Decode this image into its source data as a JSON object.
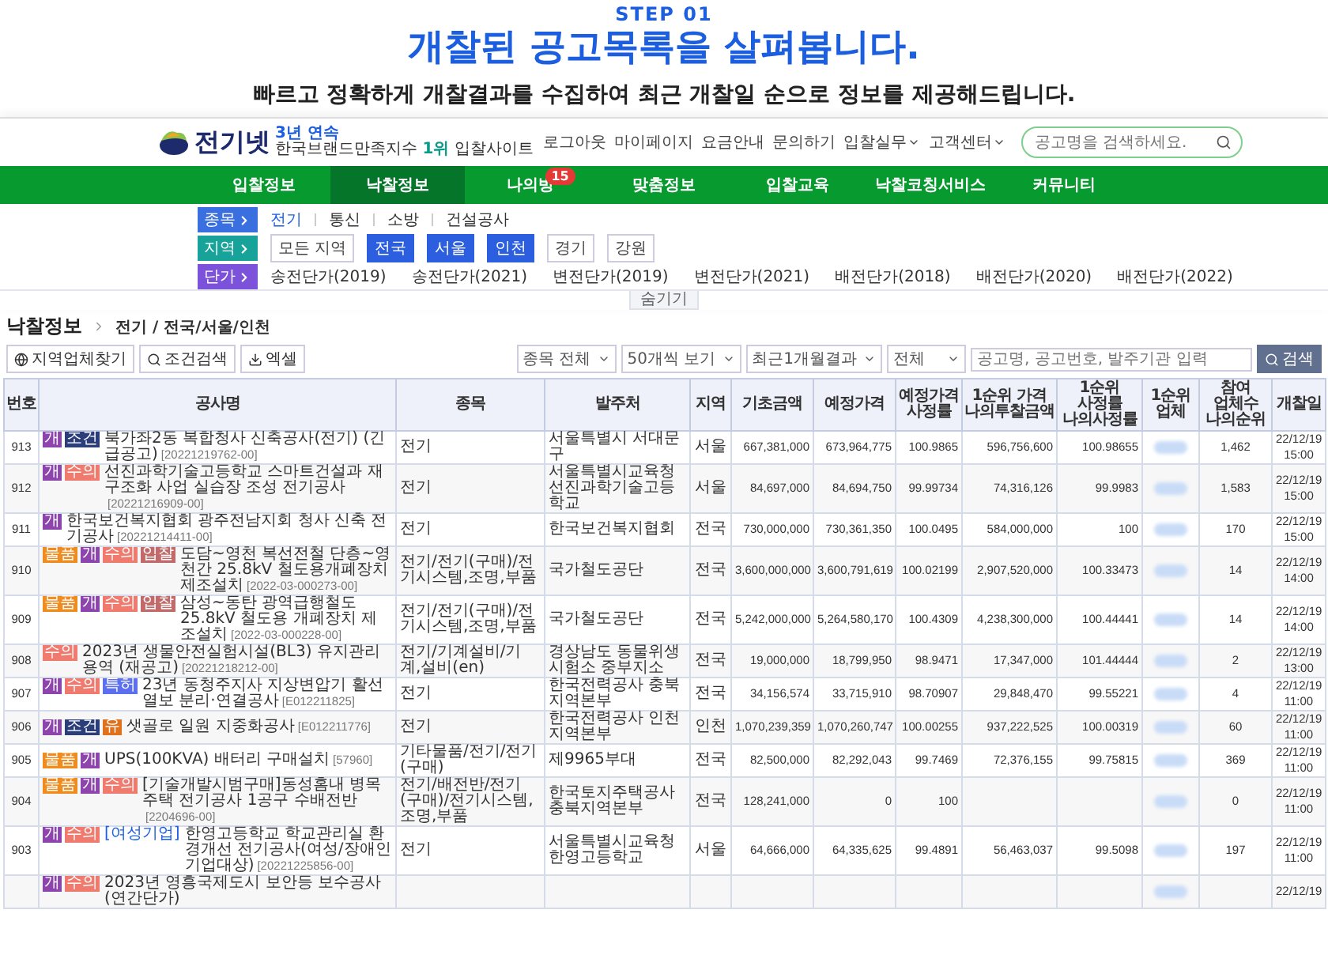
{
  "hero": {
    "step": "STEP 01",
    "title": "개찰된 공고목록을 살펴봅니다.",
    "subtitle": "빠르고 정확하게 개찰결과를 수집하여 최근 개찰일 순으로 정보를 제공해드립니다."
  },
  "site": {
    "logo": "전기넷",
    "award_top": "3년 연속",
    "award_name": "한국브랜드만족지수",
    "award_rank": "1위",
    "award_tail": "입찰사이트",
    "top_links": [
      {
        "label": "로그아웃",
        "dropdown": false
      },
      {
        "label": "마이페이지",
        "dropdown": false
      },
      {
        "label": "요금안내",
        "dropdown": false
      },
      {
        "label": "문의하기",
        "dropdown": false
      },
      {
        "label": "입찰실무",
        "dropdown": true
      },
      {
        "label": "고객센터",
        "dropdown": true
      }
    ],
    "search": {
      "placeholder": "공고명을 검색하세요."
    },
    "nav": [
      {
        "label": "입찰정보",
        "selected": false
      },
      {
        "label": "낙찰정보",
        "selected": true
      },
      {
        "label": "나의방",
        "selected": false,
        "badge": "15"
      },
      {
        "label": "맞춤정보",
        "selected": false
      },
      {
        "label": "입찰교육",
        "selected": false
      },
      {
        "label": "낙찰코칭서비스",
        "selected": false
      },
      {
        "label": "커뮤니티",
        "selected": false
      }
    ],
    "filters": [
      {
        "label": "종목",
        "color": "#3a6fe0",
        "kind": "links",
        "options": [
          {
            "label": "전기",
            "selected": true
          },
          {
            "label": "통신",
            "selected": false
          },
          {
            "label": "소방",
            "selected": false
          },
          {
            "label": "건설공사",
            "selected": false
          }
        ]
      },
      {
        "label": "지역",
        "color": "#17a39a",
        "kind": "chips",
        "options": [
          {
            "label": "모든 지역",
            "selected": false
          },
          {
            "label": "전국",
            "selected": true
          },
          {
            "label": "서울",
            "selected": true
          },
          {
            "label": "인천",
            "selected": true
          },
          {
            "label": "경기",
            "selected": false
          },
          {
            "label": "강원",
            "selected": false
          }
        ]
      },
      {
        "label": "단가",
        "color": "#7b52d9",
        "kind": "links",
        "options": [
          {
            "label": "송전단가(2019)",
            "selected": false
          },
          {
            "label": "송전단가(2021)",
            "selected": false
          },
          {
            "label": "변전단가(2019)",
            "selected": false
          },
          {
            "label": "변전단가(2021)",
            "selected": false
          },
          {
            "label": "배전단가(2018)",
            "selected": false
          },
          {
            "label": "배전단가(2020)",
            "selected": false
          },
          {
            "label": "배전단가(2022)",
            "selected": false
          }
        ]
      }
    ],
    "hide_button": "숨기기"
  },
  "breadcrumb": {
    "title": "낙찰정보",
    "path": "전기 / 전국/서울/인천"
  },
  "toolbar": {
    "buttons": [
      "지역업체찾기",
      "조건검색",
      "엑셀"
    ],
    "selects": [
      "종목 전체",
      "50개씩 보기",
      "최근1개월결과",
      "전체"
    ],
    "search_placeholder": "공고명, 공고번호, 발주기관 입력",
    "search_button": "검색"
  },
  "table": {
    "columns": [
      "번호",
      "공사명",
      "종목",
      "발주처",
      "지역",
      "기초금액",
      "예정가격",
      "예정가격 사정률",
      "1순위 가격 나의투찰금액",
      "1순위 사정률 나의사정률",
      "1순위 업체",
      "참여 업체수 나의순위",
      "개찰일"
    ],
    "rows": [
      {
        "no": "913",
        "tags": [
          {
            "label": "개",
            "color": "#8e44ad"
          },
          {
            "label": "조건",
            "color": "#2c3e7a"
          }
        ],
        "title": "북가좌2동 복합청사 신축공사(전기) (긴급공고)",
        "code": "[20221219762-00]",
        "type": "전기",
        "client": "서울특별시 서대문구",
        "region": "서울",
        "base": "667,381,000",
        "planned": "673,964,775",
        "rate": "100.9865",
        "first_price": "596,756,600",
        "first_rate": "100.98655",
        "count": "1,462",
        "date": "22/12/19",
        "time": "15:00"
      },
      {
        "no": "912",
        "tags": [
          {
            "label": "개",
            "color": "#8e44ad"
          },
          {
            "label": "수의",
            "color": "#f07a6e"
          }
        ],
        "title": "선진과학기술고등학교 스마트건설과 재구조화 사업 실습장 조성 전기공사",
        "code": "[20221216909-00]",
        "type": "전기",
        "client": "서울특별시교육청 선진과학기술고등학교",
        "region": "서울",
        "base": "84,697,000",
        "planned": "84,694,750",
        "rate": "99.99734",
        "first_price": "74,316,126",
        "first_rate": "99.9983",
        "count": "1,583",
        "date": "22/12/19",
        "time": "15:00"
      },
      {
        "no": "911",
        "tags": [
          {
            "label": "개",
            "color": "#8e44ad"
          }
        ],
        "title": "한국보건복지협회 광주전남지회 청사 신축 전기공사",
        "code": "[20221214411-00]",
        "type": "전기",
        "client": "한국보건복지협회",
        "region": "전국",
        "base": "730,000,000",
        "planned": "730,361,350",
        "rate": "100.0495",
        "first_price": "584,000,000",
        "first_rate": "100",
        "count": "170",
        "date": "22/12/19",
        "time": "15:00"
      },
      {
        "no": "910",
        "tags": [
          {
            "label": "물품",
            "color": "#f08c1e"
          },
          {
            "label": "개",
            "color": "#8e44ad"
          },
          {
            "label": "수의",
            "color": "#f07a6e"
          },
          {
            "label": "입찰",
            "color": "#c26a6a"
          }
        ],
        "title": "도담~영천 복선전철 단층~영천간 25.8kV 철도용개폐장치 제조설치",
        "code": "[2022-03-000273-00]",
        "type": "전기/전기(구매)/전기시스템,조명,부품",
        "client": "국가철도공단",
        "region": "전국",
        "base": "3,600,000,000",
        "planned": "3,600,791,619",
        "rate": "100.02199",
        "first_price": "2,907,520,000",
        "first_rate": "100.33473",
        "count": "14",
        "date": "22/12/19",
        "time": "14:00"
      },
      {
        "no": "909",
        "tags": [
          {
            "label": "물품",
            "color": "#f08c1e"
          },
          {
            "label": "개",
            "color": "#8e44ad"
          },
          {
            "label": "수의",
            "color": "#f07a6e"
          },
          {
            "label": "입찰",
            "color": "#c26a6a"
          }
        ],
        "title": "삼성~동탄 광역급행철도 25.8kV 철도용 개폐장치 제조설치",
        "code": "[2022-03-000228-00]",
        "type": "전기/전기(구매)/전기시스템,조명,부품",
        "client": "국가철도공단",
        "region": "전국",
        "base": "5,242,000,000",
        "planned": "5,264,580,170",
        "rate": "100.4309",
        "first_price": "4,238,300,000",
        "first_rate": "100.44441",
        "count": "14",
        "date": "22/12/19",
        "time": "14:00"
      },
      {
        "no": "908",
        "tags": [
          {
            "label": "수의",
            "color": "#f07a6e"
          }
        ],
        "title": "2023년 생물안전실험시설(BL3) 유지관리 용역 (재공고)",
        "code": "[20221218212-00]",
        "type": "전기/기계설비/기계,설비(en)",
        "client": "경상남도 동물위생시험소 중부지소",
        "region": "전국",
        "base": "19,000,000",
        "planned": "18,799,950",
        "rate": "98.9471",
        "first_price": "17,347,000",
        "first_rate": "101.44444",
        "count": "2",
        "date": "22/12/19",
        "time": "13:00"
      },
      {
        "no": "907",
        "tags": [
          {
            "label": "개",
            "color": "#8e44ad"
          },
          {
            "label": "수의",
            "color": "#f07a6e"
          },
          {
            "label": "특허",
            "color": "#5b6ff0"
          }
        ],
        "title": "23년 동청주지사 지상변압기 활선 열보 분리·연결공사",
        "code": "[E012211825]",
        "type": "전기",
        "client": "한국전력공사 충북지역본부",
        "region": "전국",
        "base": "34,156,574",
        "planned": "33,715,910",
        "rate": "98.70907",
        "first_price": "29,848,470",
        "first_rate": "99.55221",
        "count": "4",
        "date": "22/12/19",
        "time": "11:00"
      },
      {
        "no": "906",
        "tags": [
          {
            "label": "개",
            "color": "#8e44ad"
          },
          {
            "label": "조건",
            "color": "#2c3e7a"
          },
          {
            "label": "유",
            "color": "#e0701a"
          }
        ],
        "title": "샛골로 일원 지중화공사",
        "code": "[E012211776]",
        "type": "전기",
        "client": "한국전력공사 인천지역본부",
        "region": "인천",
        "base": "1,070,239,359",
        "planned": "1,070,260,747",
        "rate": "100.00255",
        "first_price": "937,222,525",
        "first_rate": "100.00319",
        "count": "60",
        "date": "22/12/19",
        "time": "11:00"
      },
      {
        "no": "905",
        "tags": [
          {
            "label": "물품",
            "color": "#f08c1e"
          },
          {
            "label": "개",
            "color": "#8e44ad"
          }
        ],
        "title": "UPS(100KVA) 배터리 구매설치",
        "code": "[57960]",
        "type": "기타물품/전기/전기(구매)",
        "client": "제9965부대",
        "region": "전국",
        "base": "82,500,000",
        "planned": "82,292,043",
        "rate": "99.7469",
        "first_price": "72,376,155",
        "first_rate": "99.75815",
        "count": "369",
        "date": "22/12/19",
        "time": "11:00"
      },
      {
        "no": "904",
        "tags": [
          {
            "label": "물품",
            "color": "#f08c1e"
          },
          {
            "label": "개",
            "color": "#8e44ad"
          },
          {
            "label": "수의",
            "color": "#f07a6e"
          }
        ],
        "title": "[기술개발시범구매]동성홈내 병목주택 전기공사 1공구 수배전반",
        "code": "[2204696-00]",
        "type": "전기/배전반/전기(구매)/전기시스템,조명,부품",
        "client": "한국토지주택공사 충북지역본부",
        "region": "전국",
        "base": "128,241,000",
        "planned": "0",
        "rate": "100",
        "count": "0",
        "date": "22/12/19",
        "time": "11:00"
      },
      {
        "no": "903",
        "tags": [
          {
            "label": "개",
            "color": "#8e44ad"
          },
          {
            "label": "수의",
            "color": "#f07a6e"
          }
        ],
        "prefix": "[여성기업]",
        "title": "한영고등학교 학교관리실 환경개선 전기공사(여성/장애인 기업대상)",
        "code": "[20221225856-00]",
        "type": "전기",
        "client": "서울특별시교육청 한영고등학교",
        "region": "서울",
        "base": "64,666,000",
        "planned": "64,335,625",
        "rate": "99.4891",
        "first_price": "56,463,037",
        "first_rate": "99.5098",
        "count": "197",
        "date": "22/12/19",
        "time": "11:00"
      },
      {
        "tags": [
          {
            "label": "개",
            "color": "#8e44ad"
          },
          {
            "label": "수의",
            "color": "#f07a6e"
          }
        ],
        "title": "2023년 영흥국제도시 보안등 보수공사(연간단가)",
        "date": "22/12/19"
      }
    ]
  }
}
